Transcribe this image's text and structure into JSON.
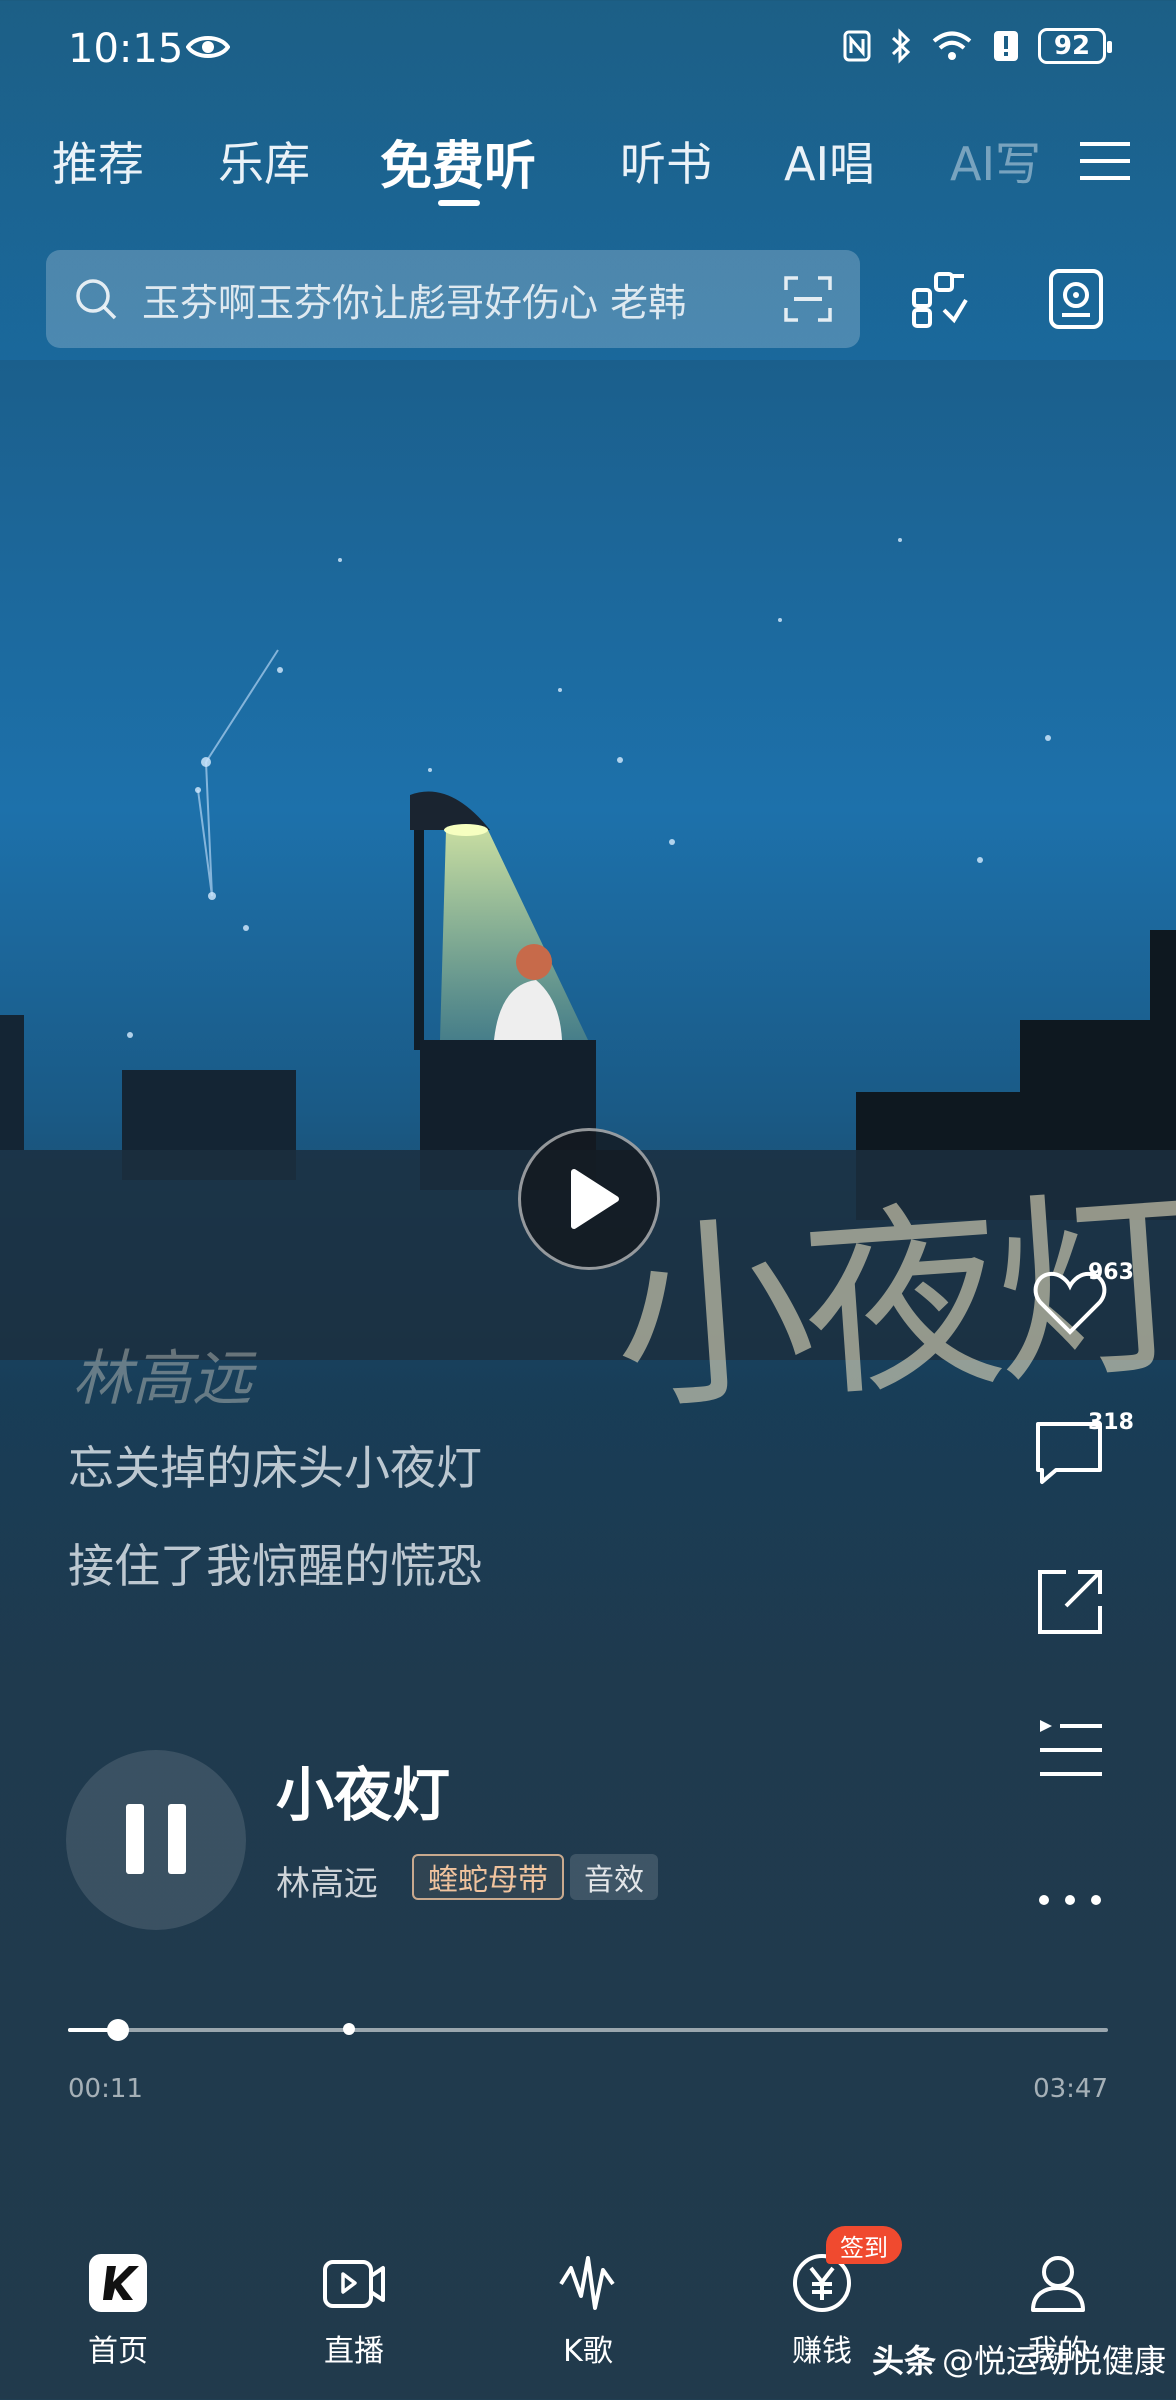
{
  "status_bar": {
    "time": "10:15",
    "battery": "92"
  },
  "top_tabs": [
    {
      "label": "推荐",
      "active": false
    },
    {
      "label": "乐库",
      "active": false
    },
    {
      "label": "免费听",
      "active": true
    },
    {
      "label": "听书",
      "active": false
    },
    {
      "label": "AI唱",
      "active": false
    },
    {
      "label": "AI写",
      "active": false
    }
  ],
  "search": {
    "placeholder": "玉芬啊玉芬你让彪哥好伤心 老韩"
  },
  "artwork": {
    "title_text": "小夜灯",
    "artist_text": "林高远"
  },
  "lyrics": [
    "忘关掉的床头小夜灯",
    "接住了我惊醒的慌恐"
  ],
  "side_actions": {
    "like_count": "963",
    "comment_count": "318"
  },
  "song": {
    "title": "小夜灯",
    "artist": "林高远",
    "tags": [
      "蝰蛇母带",
      "音效"
    ]
  },
  "progress": {
    "elapsed": "00:11",
    "total": "03:47",
    "played_fraction": 0.048,
    "buffered_fraction": 0.27
  },
  "bottom_nav": [
    {
      "label": "首页",
      "icon": "home-k-icon"
    },
    {
      "label": "直播",
      "icon": "live-icon"
    },
    {
      "label": "K歌",
      "icon": "karaoke-icon"
    },
    {
      "label": "赚钱",
      "icon": "yen-coin-icon",
      "badge": "签到"
    },
    {
      "label": "我的",
      "icon": "profile-icon"
    }
  ],
  "watermark": {
    "source": "头条",
    "handle": "@悦运动悦健康"
  }
}
